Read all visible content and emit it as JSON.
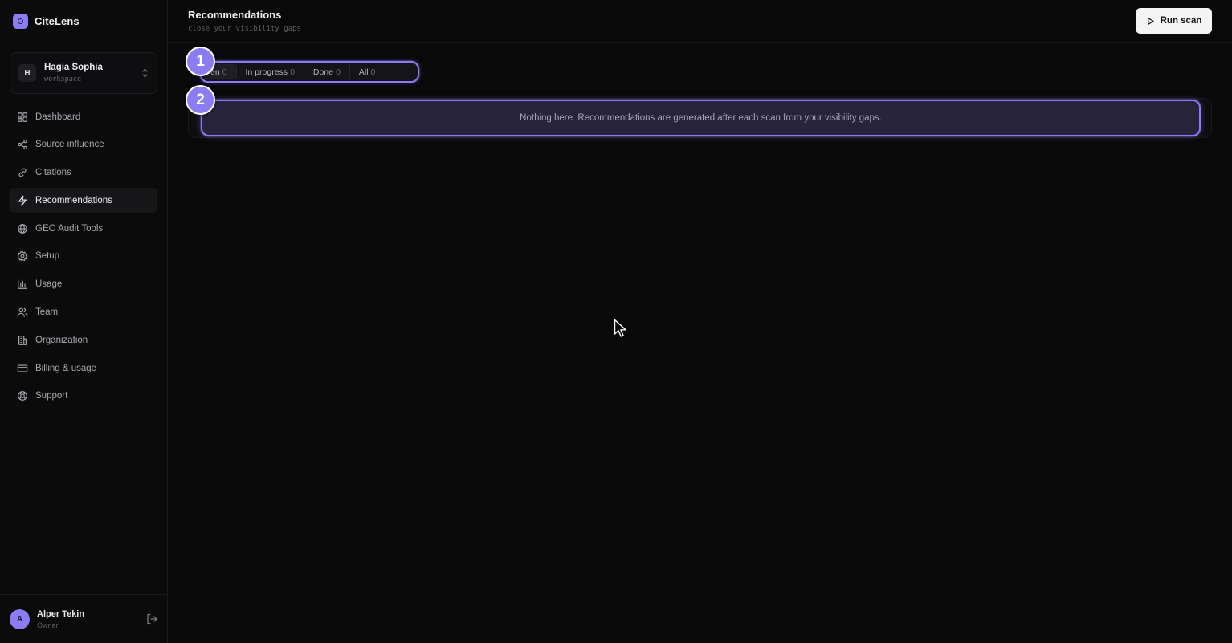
{
  "brand": {
    "name": "CiteLens"
  },
  "workspace": {
    "initial": "H",
    "name": "Hagia Sophia",
    "subtitle": "workspace"
  },
  "sidebar": {
    "items": [
      {
        "label": "Dashboard",
        "icon": "grid-icon"
      },
      {
        "label": "Source influence",
        "icon": "share-icon"
      },
      {
        "label": "Citations",
        "icon": "link-icon"
      },
      {
        "label": "Recommendations",
        "icon": "lightning-icon",
        "active": true
      },
      {
        "label": "GEO Audit Tools",
        "icon": "globe-icon"
      },
      {
        "label": "Setup",
        "icon": "gear-icon"
      },
      {
        "label": "Usage",
        "icon": "bar-chart-icon"
      },
      {
        "label": "Team",
        "icon": "users-icon"
      },
      {
        "label": "Organization",
        "icon": "building-icon"
      },
      {
        "label": "Billing & usage",
        "icon": "credit-card-icon"
      },
      {
        "label": "Support",
        "icon": "life-buoy-icon"
      }
    ]
  },
  "user": {
    "initial": "A",
    "name": "Alper Tekin",
    "role": "Owner"
  },
  "header": {
    "title": "Recommendations",
    "subtitle": "close your visibility gaps",
    "run_scan_label": "Run scan"
  },
  "filters": [
    {
      "label": "en",
      "count": "0"
    },
    {
      "label": "In progress",
      "count": "0"
    },
    {
      "label": "Done",
      "count": "0"
    },
    {
      "label": "All",
      "count": "0"
    }
  ],
  "empty_state": {
    "message": "Nothing here. Recommendations are generated after each scan from your visibility gaps."
  },
  "markers": [
    "1",
    "2"
  ],
  "colors": {
    "accent": "#8b7cf2",
    "background": "#09090a",
    "button_bg": "#f4f4f5"
  }
}
